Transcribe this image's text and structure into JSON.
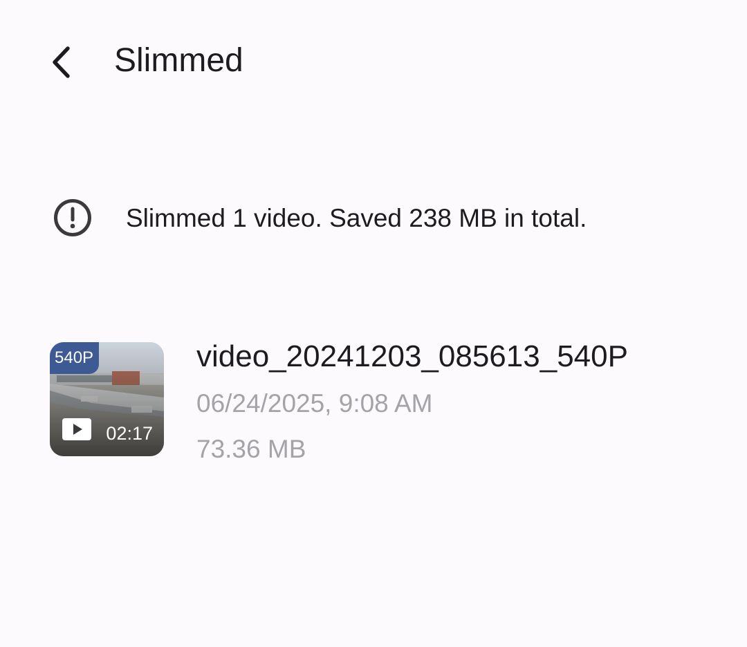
{
  "header": {
    "back_icon": "chevron-left-icon",
    "title": "Slimmed"
  },
  "summary": {
    "icon": "exclamation-circle-icon",
    "text": "Slimmed 1 video. Saved 238 MB in total."
  },
  "videos": [
    {
      "badge": "540P",
      "duration": "02:17",
      "play_icon": "play-icon",
      "name": "video_20241203_085613_540P",
      "date": "06/24/2025, 9:08 AM",
      "size": "73.36 MB"
    }
  ],
  "colors": {
    "background": "#fcfafc",
    "text_primary": "#1c1b1f",
    "text_secondary": "#a3a3a8",
    "badge": "#3d5a95"
  }
}
